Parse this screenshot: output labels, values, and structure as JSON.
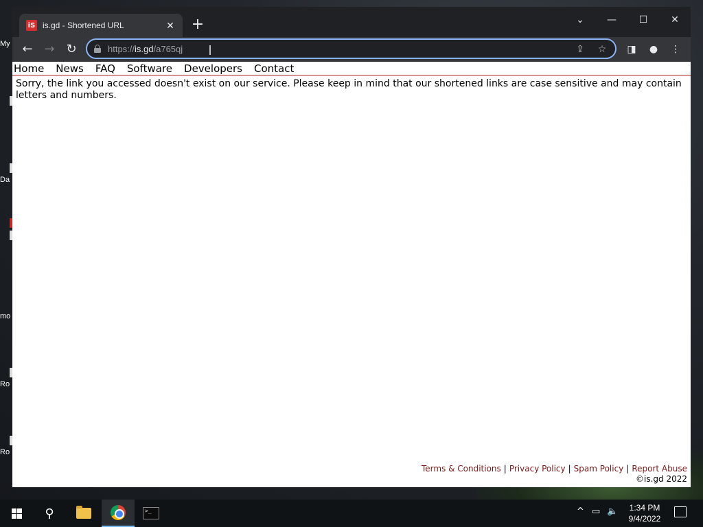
{
  "desktop": {
    "icons": [
      {
        "label": "My",
        "red": false
      },
      {
        "label": "Da",
        "red": false
      },
      {
        "label": "",
        "red": true
      },
      {
        "label": "mo",
        "red": false
      },
      {
        "label": "Ro",
        "red": false
      },
      {
        "label": "Ro",
        "red": false
      }
    ]
  },
  "browser": {
    "tab": {
      "title": "is.gd - Shortened URL",
      "favicon": "iS",
      "close": "✕"
    },
    "new_tab": "+",
    "window_controls": {
      "tab_search": "⌄",
      "minimize": "—",
      "maximize": "☐",
      "close": "✕"
    },
    "nav": {
      "back": "←",
      "forward": "→",
      "reload": "↻"
    },
    "omnibox": {
      "url_scheme": "https://",
      "url_host": "is.gd",
      "url_path": "/a765qj"
    },
    "omni_icons": {
      "share": "⇪",
      "bookmark": "☆"
    },
    "toolbar_icons": {
      "side_panel": "◨",
      "profile": "●",
      "menu": "⋮"
    }
  },
  "page": {
    "nav_links": [
      "Home",
      "News",
      "FAQ",
      "Software",
      "Developers",
      "Contact"
    ],
    "message": "Sorry, the link you accessed doesn't exist on our service. Please keep in mind that our shortened links are case sensitive and may contain letters and numbers.",
    "footer": {
      "links": [
        "Terms & Conditions",
        "Privacy Policy",
        "Spam Policy",
        "Report Abuse"
      ],
      "separator": "|",
      "copyright": "©is.gd 2022"
    }
  },
  "taskbar": {
    "search_glyph": "⚲",
    "terminal_text": ">_",
    "tray": {
      "chevron": "^",
      "network": "▭",
      "volume": "🔈"
    },
    "clock": {
      "time": "1:34 PM",
      "date": "9/4/2022"
    }
  }
}
